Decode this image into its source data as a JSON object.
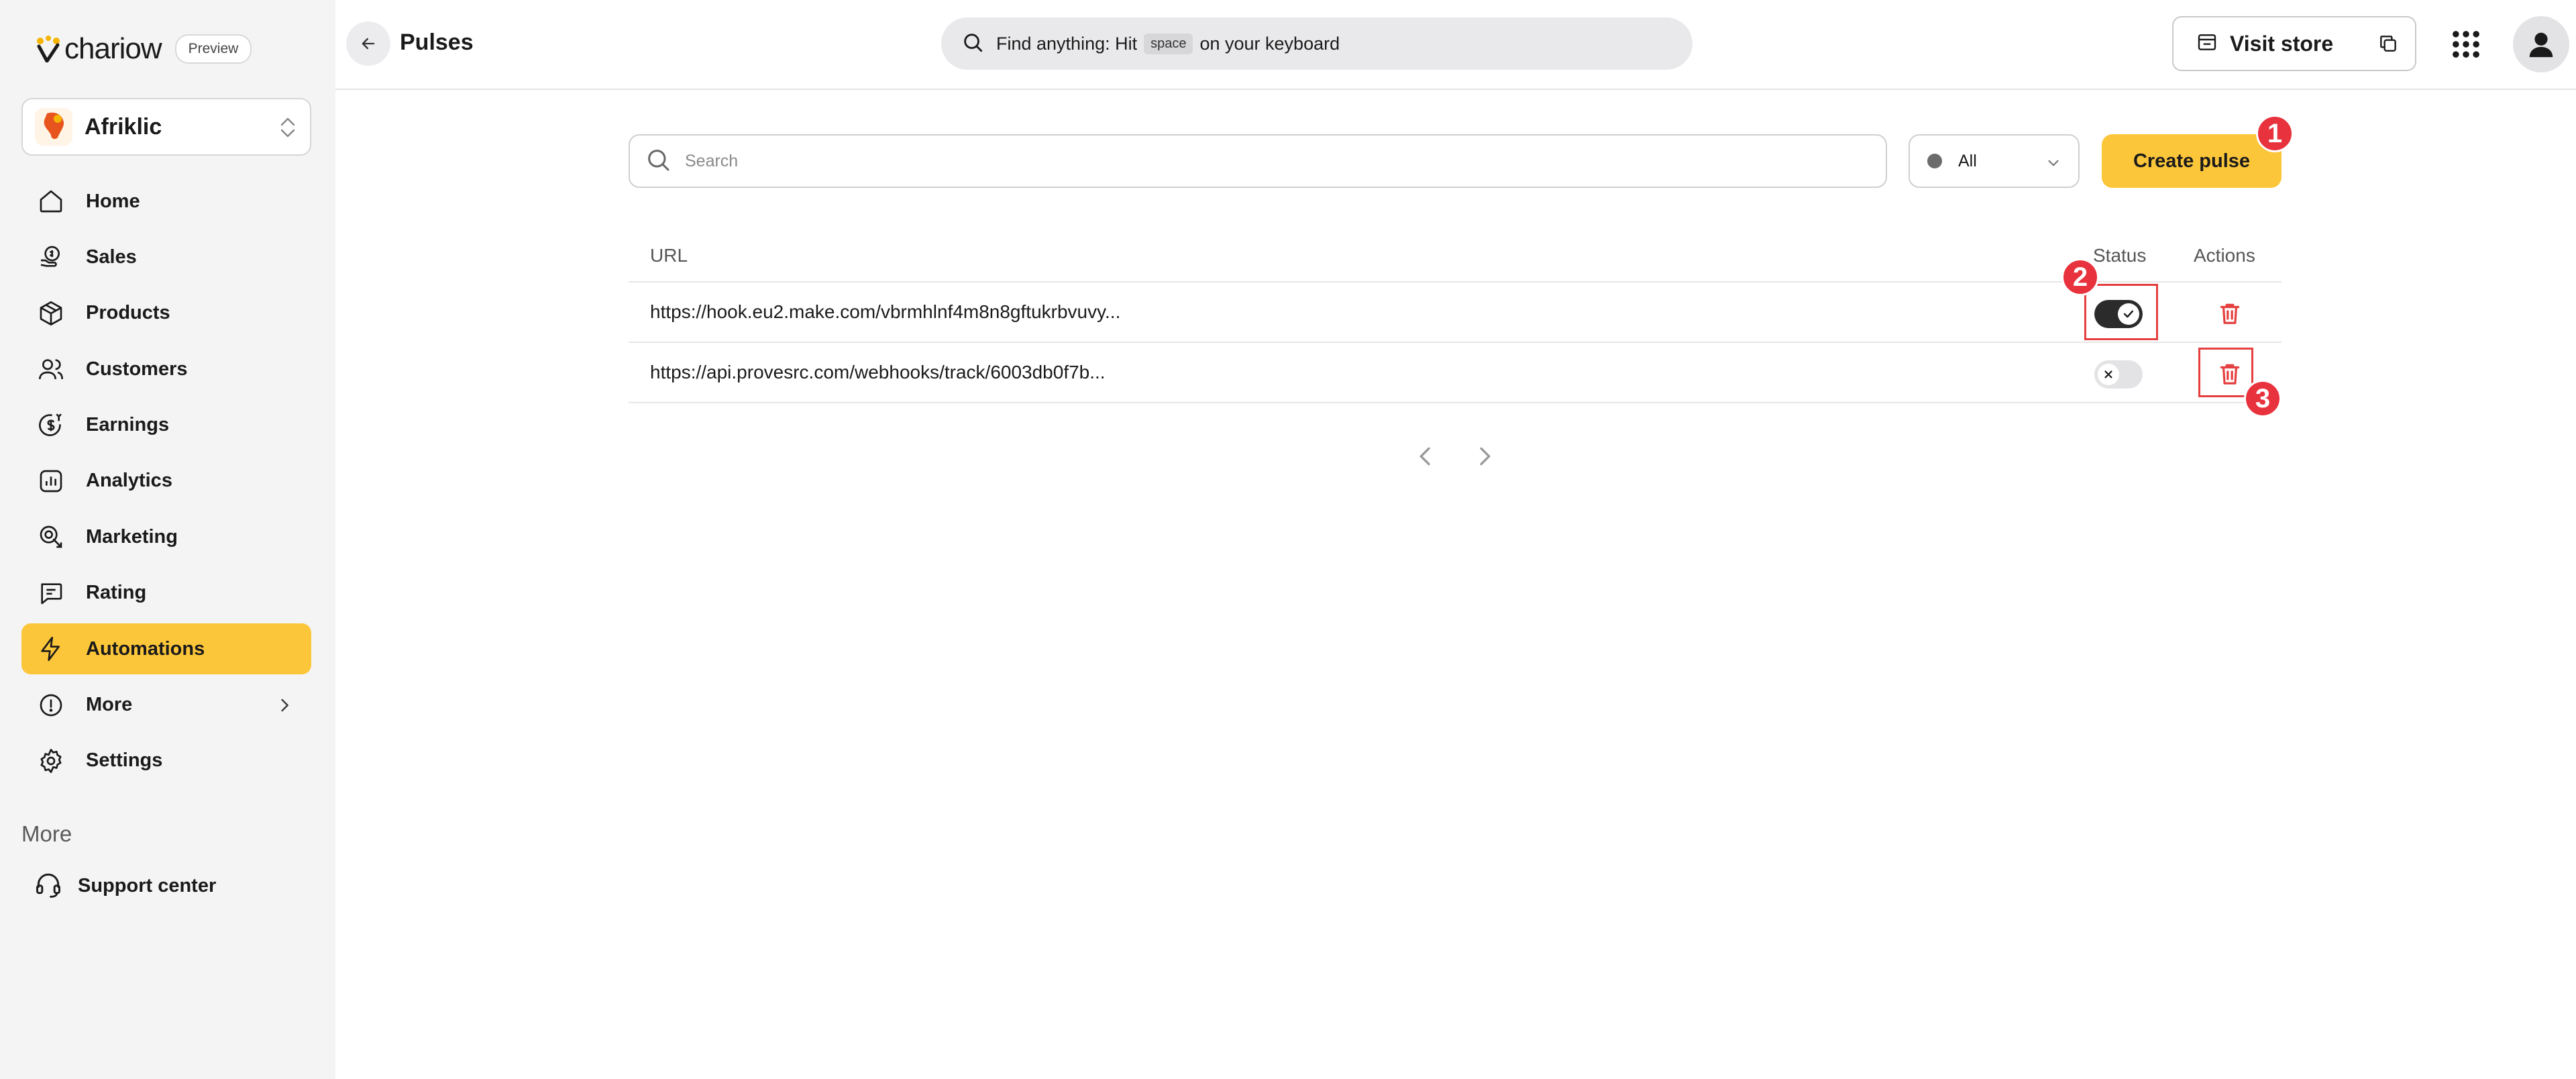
{
  "brand": {
    "logo_text": "chariow",
    "preview_badge": "Preview"
  },
  "store_switcher": {
    "name": "Afriklic",
    "avatar_text": "AFRIKLIC"
  },
  "sidebar": {
    "items": [
      {
        "label": "Home",
        "icon": "home-icon"
      },
      {
        "label": "Sales",
        "icon": "sales-icon"
      },
      {
        "label": "Products",
        "icon": "box-icon"
      },
      {
        "label": "Customers",
        "icon": "users-icon"
      },
      {
        "label": "Earnings",
        "icon": "earnings-icon"
      },
      {
        "label": "Analytics",
        "icon": "chart-icon"
      },
      {
        "label": "Marketing",
        "icon": "marketing-icon"
      },
      {
        "label": "Rating",
        "icon": "rating-icon"
      },
      {
        "label": "Automations",
        "icon": "lightning-icon",
        "active": true
      },
      {
        "label": "More",
        "icon": "info-circle-icon"
      },
      {
        "label": "Settings",
        "icon": "gear-icon"
      }
    ],
    "more_heading": "More",
    "support_label": "Support center"
  },
  "topbar": {
    "title": "Pulses",
    "search_prefix": "Find anything: Hit",
    "search_key": "space",
    "search_suffix": "on your keyboard",
    "visit_store_label": "Visit store"
  },
  "toolbar": {
    "search_placeholder": "Search",
    "filter_value": "All",
    "create_label": "Create pulse"
  },
  "table": {
    "headers": {
      "url": "URL",
      "status": "Status",
      "actions": "Actions"
    },
    "rows": [
      {
        "url": "https://hook.eu2.make.com/vbrmhlnf4m8n8gftukrbvuvy...",
        "status": "on"
      },
      {
        "url": "https://api.provesrc.com/webhooks/track/6003db0f7b...",
        "status": "off"
      }
    ]
  },
  "annotations": [
    "1",
    "2",
    "3"
  ],
  "colors": {
    "accent": "#fcc63a",
    "sidebar_bg": "#f4f4f5",
    "danger": "#e53f3f",
    "toggle_on": "#2b2b2b"
  }
}
